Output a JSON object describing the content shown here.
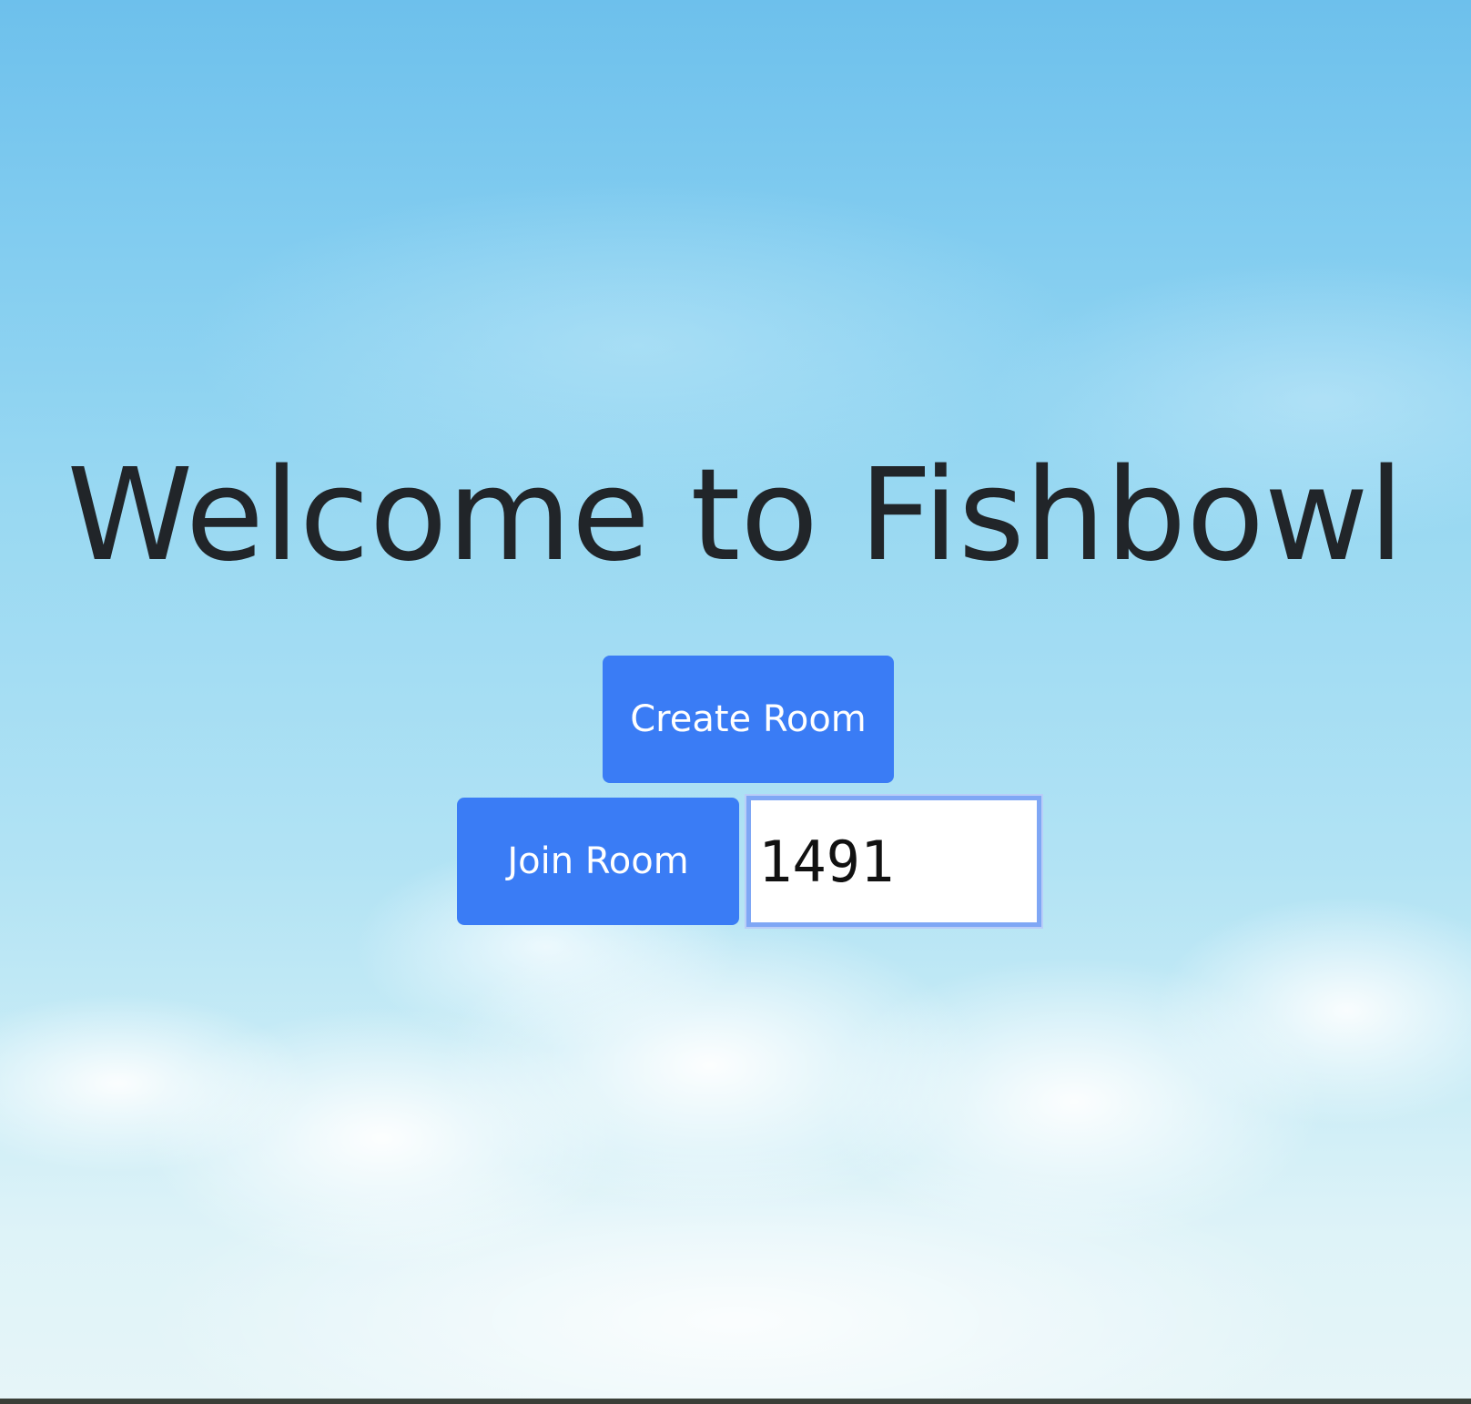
{
  "page": {
    "title": "Welcome to Fishbowl"
  },
  "actions": {
    "create_room_label": "Create Room",
    "join_room_label": "Join Room",
    "room_code_value": "1491"
  },
  "colors": {
    "button_background": "#3a7cf5",
    "button_text": "#ffffff",
    "title_text": "#212529",
    "input_focus_border": "#7fa7f5"
  }
}
